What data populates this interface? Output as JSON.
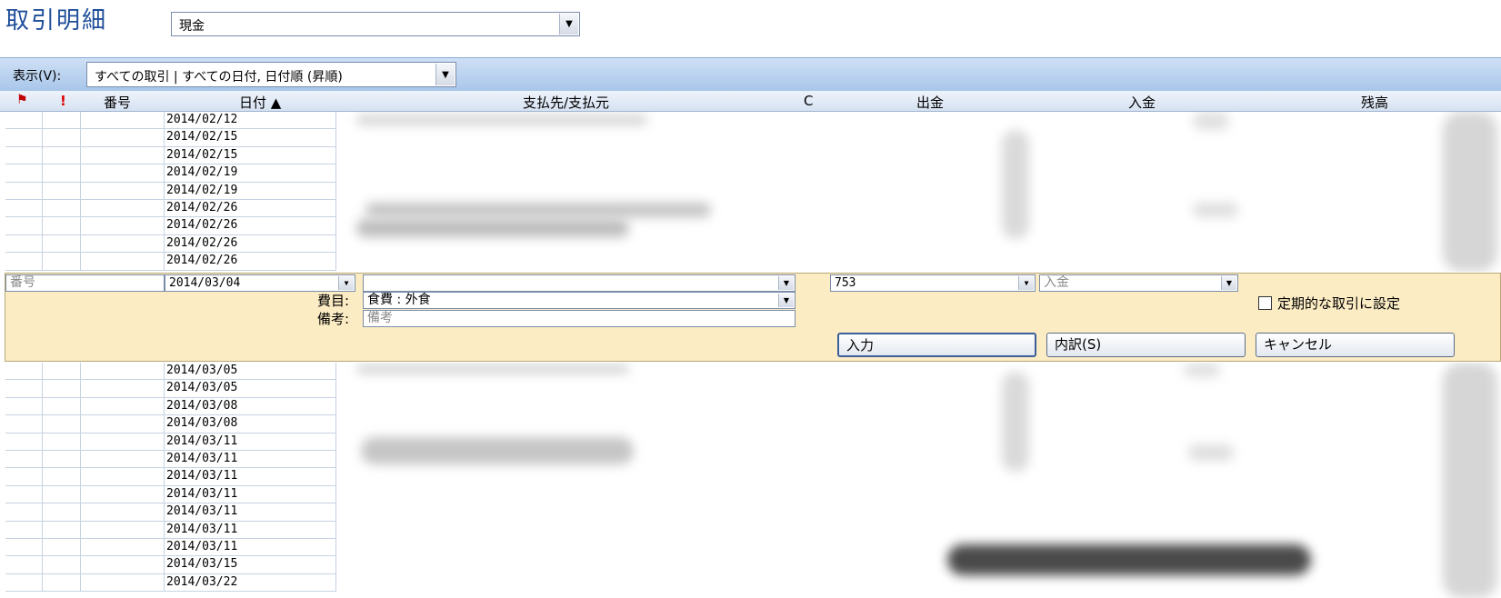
{
  "header": {
    "title": "取引明細",
    "account": "現金"
  },
  "toolbar": {
    "view_label": "表示(V):",
    "view_value": "すべての取引 | すべての日付, 日付順 (昇順)"
  },
  "columns": {
    "flag": "flag-icon",
    "important": "!",
    "number": "番号",
    "date": "日付 ▲",
    "payee": "支払先/支払元",
    "cleared": "C",
    "withdrawal": "出金",
    "deposit": "入金",
    "balance": "残高"
  },
  "rows_before": [
    "2014/02/12",
    "2014/02/15",
    "2014/02/15",
    "2014/02/19",
    "2014/02/19",
    "2014/02/26",
    "2014/02/26",
    "2014/02/26",
    "2014/02/26"
  ],
  "edit": {
    "number_placeholder": "番号",
    "date": "2014/03/04",
    "payee": "",
    "category_label": "費目:",
    "category": "食費 : 外食",
    "memo_label": "備考:",
    "memo_placeholder": "備考",
    "withdrawal": "753",
    "deposit_placeholder": "入金",
    "recurring_label": "定期的な取引に設定",
    "enter_button": "入力",
    "split_button": "内訳(S)",
    "cancel_button": "キャンセル"
  },
  "rows_after": [
    "2014/03/05",
    "2014/03/05",
    "2014/03/08",
    "2014/03/08",
    "2014/03/11",
    "2014/03/11",
    "2014/03/11",
    "2014/03/11",
    "2014/03/11",
    "2014/03/11",
    "2014/03/11",
    "2014/03/15",
    "2014/03/22"
  ]
}
